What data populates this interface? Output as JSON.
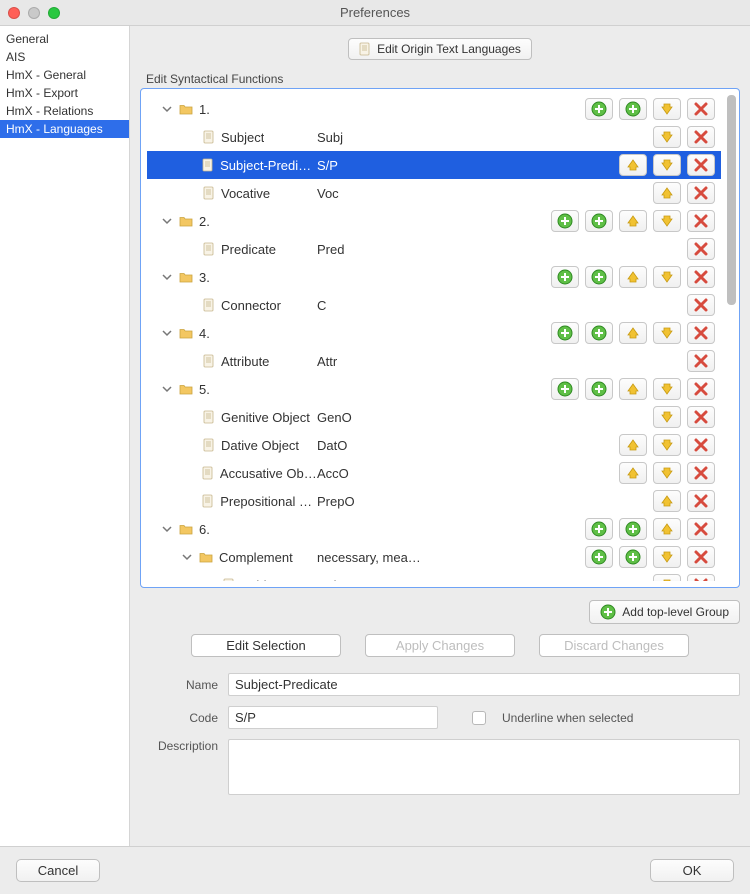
{
  "window": {
    "title": "Preferences"
  },
  "sidebar": {
    "items": [
      {
        "label": "General",
        "selected": false
      },
      {
        "label": "AIS",
        "selected": false
      },
      {
        "label": "HmX - General",
        "selected": false
      },
      {
        "label": "HmX - Export",
        "selected": false
      },
      {
        "label": "HmX - Relations",
        "selected": false
      },
      {
        "label": "HmX - Languages",
        "selected": true
      }
    ]
  },
  "buttons": {
    "editOrigin": "Edit Origin Text Languages",
    "addTopGroup": "Add top-level Group",
    "editSelection": "Edit Selection",
    "applyChanges": "Apply Changes",
    "discardChanges": "Discard Changes",
    "cancel": "Cancel",
    "ok": "OK"
  },
  "section": {
    "title": "Edit Syntactical Functions"
  },
  "form": {
    "nameLabel": "Name",
    "nameValue": "Subject-Predicate",
    "codeLabel": "Code",
    "codeValue": "S/P",
    "underlineLabel": "Underline when selected",
    "descLabel": "Description"
  },
  "tree": [
    {
      "type": "group",
      "indent": 0,
      "label": "1.",
      "expanded": true,
      "actions": [
        "add",
        "add",
        "down",
        "delete"
      ],
      "selected": false
    },
    {
      "type": "leaf",
      "indent": 1,
      "label": "Subject",
      "code": "Subj",
      "actions": [
        "down",
        "delete"
      ],
      "selected": false
    },
    {
      "type": "leaf",
      "indent": 1,
      "label": "Subject-Predicate",
      "code": "S/P",
      "actions": [
        "up",
        "down",
        "delete"
      ],
      "selected": true
    },
    {
      "type": "leaf",
      "indent": 1,
      "label": "Vocative",
      "code": "Voc",
      "actions": [
        "up",
        "delete"
      ],
      "selected": false
    },
    {
      "type": "group",
      "indent": 0,
      "label": "2.",
      "expanded": true,
      "actions": [
        "add",
        "add",
        "up",
        "down",
        "delete"
      ],
      "selected": false
    },
    {
      "type": "leaf",
      "indent": 1,
      "label": "Predicate",
      "code": "Pred",
      "actions": [
        "delete"
      ],
      "selected": false
    },
    {
      "type": "group",
      "indent": 0,
      "label": "3.",
      "expanded": true,
      "actions": [
        "add",
        "add",
        "up",
        "down",
        "delete"
      ],
      "selected": false
    },
    {
      "type": "leaf",
      "indent": 1,
      "label": "Connector",
      "code": "C",
      "actions": [
        "delete"
      ],
      "selected": false
    },
    {
      "type": "group",
      "indent": 0,
      "label": "4.",
      "expanded": true,
      "actions": [
        "add",
        "add",
        "up",
        "down",
        "delete"
      ],
      "selected": false
    },
    {
      "type": "leaf",
      "indent": 1,
      "label": "Attribute",
      "code": "Attr",
      "actions": [
        "delete"
      ],
      "selected": false
    },
    {
      "type": "group",
      "indent": 0,
      "label": "5.",
      "expanded": true,
      "actions": [
        "add",
        "add",
        "up",
        "down",
        "delete"
      ],
      "selected": false
    },
    {
      "type": "leaf",
      "indent": 1,
      "label": "Genitive Object",
      "code": "GenO",
      "actions": [
        "down",
        "delete"
      ],
      "selected": false
    },
    {
      "type": "leaf",
      "indent": 1,
      "label": "Dative Object",
      "code": "DatO",
      "actions": [
        "up",
        "down",
        "delete"
      ],
      "selected": false
    },
    {
      "type": "leaf",
      "indent": 1,
      "label": "Accusative Object",
      "code": "AccO",
      "actions": [
        "up",
        "down",
        "delete"
      ],
      "selected": false
    },
    {
      "type": "leaf",
      "indent": 1,
      "label": "Prepositional O…",
      "code": "PrepO",
      "actions": [
        "up",
        "delete"
      ],
      "selected": false
    },
    {
      "type": "group",
      "indent": 0,
      "label": "6.",
      "expanded": true,
      "actions": [
        "add",
        "add",
        "up",
        "delete"
      ],
      "selected": false
    },
    {
      "type": "group",
      "indent": 1,
      "label": "Complement",
      "code": "necessary, mea…",
      "expanded": true,
      "actions": [
        "add",
        "add",
        "down",
        "delete"
      ],
      "selected": false
    },
    {
      "type": "leaf",
      "indent": 2,
      "label": "Subject-Ind…",
      "code": "SIdC",
      "actions": [
        "down",
        "delete"
      ],
      "selected": false
    }
  ],
  "icons": {
    "add": "plus-circle-icon",
    "up": "arrow-up-icon",
    "down": "arrow-down-icon",
    "delete": "x-icon"
  },
  "colors": {
    "selection": "#1f5fe0",
    "addGreen": "#3eab2f",
    "arrowYellow": "#eab308",
    "deleteRed": "#d23a2d"
  }
}
